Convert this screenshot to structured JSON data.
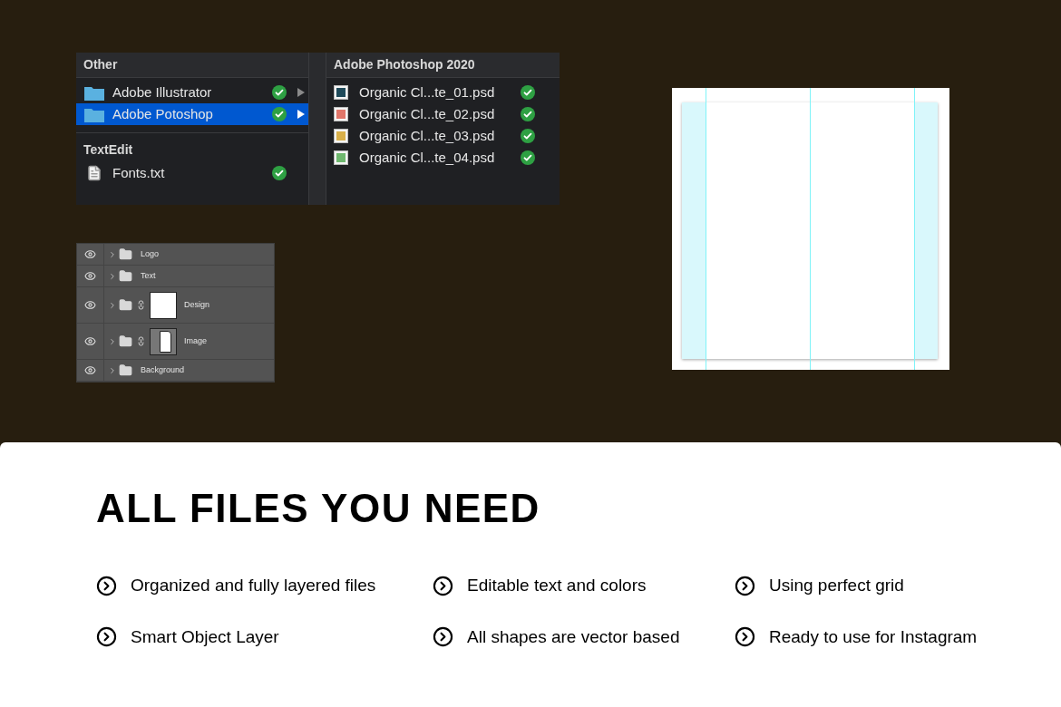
{
  "finder": {
    "sections": [
      {
        "title": "Other",
        "items": [
          {
            "name": "Adobe Illustrator",
            "kind": "folder",
            "selected": false
          },
          {
            "name": "Adobe Potoshop",
            "kind": "folder",
            "selected": true
          }
        ]
      },
      {
        "title": "TextEdit",
        "items": [
          {
            "name": "Fonts.txt",
            "kind": "document",
            "selected": false
          }
        ]
      }
    ],
    "preview": {
      "title": "Adobe Photoshop 2020",
      "files": [
        {
          "name": "Organic Cl...te_01.psd",
          "color": "#1f4a5a"
        },
        {
          "name": "Organic Cl...te_02.psd",
          "color": "#e0766a"
        },
        {
          "name": "Organic Cl...te_03.psd",
          "color": "#d9b04a"
        },
        {
          "name": "Organic Cl...te_04.psd",
          "color": "#6fb86f"
        }
      ]
    }
  },
  "layers": [
    {
      "name": "Logo",
      "kind": "group"
    },
    {
      "name": "Text",
      "kind": "group"
    },
    {
      "name": "Design",
      "kind": "solid"
    },
    {
      "name": "Image",
      "kind": "masked"
    },
    {
      "name": "Background",
      "kind": "group"
    }
  ],
  "heading": "ALL FILES YOU NEED",
  "features": [
    "Organized and fully layered files",
    "Editable text and colors",
    "Using perfect grid",
    "Smart Object Layer",
    "All shapes are vector based",
    "Ready to use for Instagram"
  ]
}
